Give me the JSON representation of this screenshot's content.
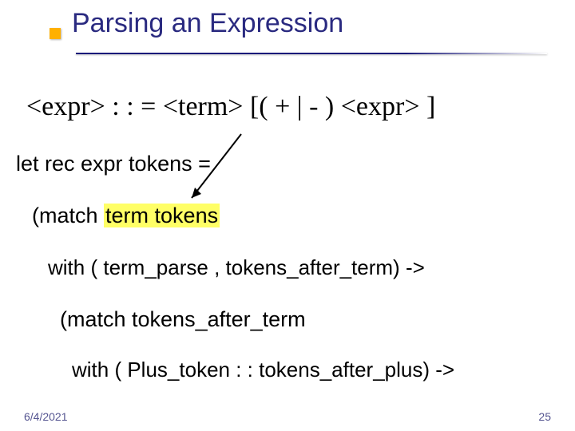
{
  "title": "Parsing an Expression",
  "grammar_rule": "<expr> : : = <term> [( + | - ) <expr> ]",
  "code": {
    "line1": "let rec expr tokens =",
    "line2_pre": "(match ",
    "line2_highlight": "term tokens",
    "line3": "with ( term_parse , tokens_after_term) ->",
    "line4": "(match tokens_after_term",
    "line5": "with ( Plus_token  : : tokens_after_plus) ->"
  },
  "footer": {
    "date": "6/4/2021",
    "page": "25"
  }
}
